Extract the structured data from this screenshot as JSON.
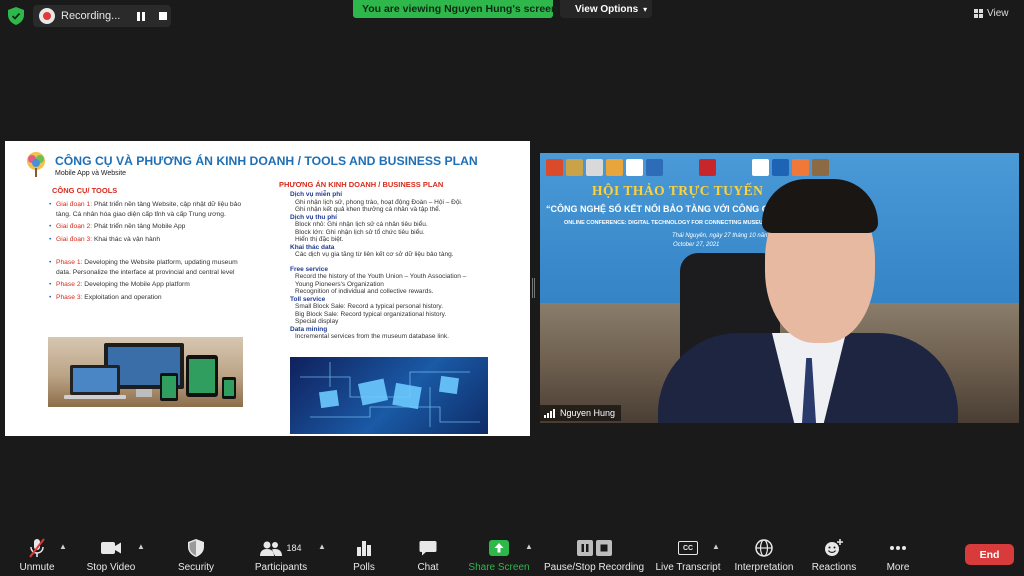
{
  "topbar": {
    "recording_label": "Recording...",
    "banner_text": "You are viewing Nguyen Hung's screen",
    "view_options_label": "View Options",
    "view_label": "View"
  },
  "slide": {
    "title": "CÔNG CỤ VÀ PHƯƠNG ÁN KINH DOANH / TOOLS AND BUSINESS PLAN",
    "subtitle": "Mobile App và Website",
    "left_heading": "CÔNG CỤ/ TOOLS",
    "left_items": [
      {
        "label": "Giai đoạn 1:",
        "text": "Phát triển nền tảng Website, cập nhật dữ liệu bảo tàng. Cá nhân hóa giao diện cấp tỉnh và cấp Trung ương."
      },
      {
        "label": "Giai đoạn 2:",
        "text": "Phát triển nền tảng Mobile App"
      },
      {
        "label": "Giai đoạn 3:",
        "text": "Khai thác và vận hành"
      },
      {
        "label": "Phase 1:",
        "text": "Developing the Website platform, updating museum data. Personalize the interface at provincial and central level"
      },
      {
        "label": "Phase 2:",
        "text": "Developing the Mobile App platform"
      },
      {
        "label": "Phase 3:",
        "text": "Exploitation and operation"
      }
    ],
    "right_heading": "PHƯƠNG ÁN KINH DOANH / BUSINESS PLAN",
    "right": {
      "free_vn": "Dịch vụ miễn phí",
      "free_vn_1": "Ghi nhận lịch sử, phong trào, hoạt động Đoàn – Hội – Đội.",
      "free_vn_2": "Ghi nhận kết quả khen thưởng cá nhân và tập thể.",
      "toll_vn": "Dịch vụ thu phí",
      "toll_vn_1": "Block nhỏ: Ghi nhận lịch sử cá nhân tiêu biểu.",
      "toll_vn_2": "Block lớn: Ghi nhận lịch sử tổ chức tiêu biểu.",
      "toll_vn_3": "Hiển thị đặc biệt.",
      "mining_vn": "Khai thác data",
      "mining_vn_1": "Các dịch vụ gia tăng từ liên kết cơ sở dữ liệu bảo tàng.",
      "free_en": "Free service",
      "free_en_1": "Record the history of the Youth Union – Youth Association –",
      "free_en_1b": "Young Pioneers's Organization",
      "free_en_2": "Recognition of individual and collective rewards.",
      "toll_en": "Toll service",
      "toll_en_1": "Small Block Sale: Record a typical personal history.",
      "toll_en_2": "Big Block Sale: Record typical organizational history.",
      "toll_en_3": "Special display",
      "mining_en": "Data mining",
      "mining_en_1": "Incremental services from the museum database link."
    }
  },
  "video": {
    "conf_title": "HỘI THẢO TRỰC TUYẾN",
    "conf_subtitle": "“CÔNG NGHỆ SỐ KẾT NỐI BẢO TÀNG VỚI CÔNG CHÚN",
    "conf_english": "ONLINE CONFERENCE: DIGITAL TECHNOLOGY FOR CONNECTING MUSEUMS WITH THE PUBLIC AUDIEN",
    "date_vn": "Thái Nguyên, ngày 27 tháng 10 năm 2021",
    "date_en": "October 27, 2021",
    "participant_name": "Nguyen Hung"
  },
  "toolbar": {
    "unmute": "Unmute",
    "stop_video": "Stop Video",
    "security": "Security",
    "participants": "Participants",
    "participants_count": "184",
    "polls": "Polls",
    "chat": "Chat",
    "share_screen": "Share Screen",
    "pause_stop_recording": "Pause/Stop Recording",
    "live_transcript": "Live Transcript",
    "cc_glyph": "CC",
    "interpretation": "Interpretation",
    "reactions": "Reactions",
    "more": "More",
    "end": "End"
  },
  "colors": {
    "banner_green": "#2eb84b",
    "slide_title_blue": "#1f6fb6",
    "slide_accent_red": "#d92a1c",
    "end_red": "#d83b3b",
    "share_green": "#2eb84b"
  }
}
